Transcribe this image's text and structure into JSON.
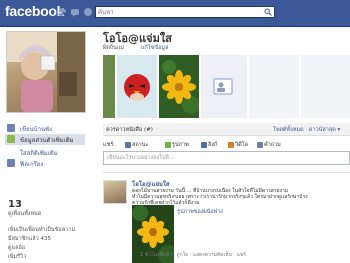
{
  "topbar": {
    "logo": "facebook",
    "search_placeholder": "ค้นหา"
  },
  "sidebar": {
    "links": [
      {
        "label": "เขียนบ้านพัง",
        "icon": "wall-icon",
        "color": "#6d84b4"
      },
      {
        "label": "ข้อมูลส่วนตัวเพิ่มเติม",
        "icon": "info-icon",
        "color": "#8cba4f"
      },
      {
        "label": "ใส่สถิติเพิ่มเติม",
        "icon": "",
        "color": ""
      },
      {
        "label": "ฟิลเกรียง",
        "icon": "photo-icon",
        "color": "#6d84b4"
      }
    ],
    "friends_count": "13",
    "friends_label": "ดูเพื่อนทั้งหมด",
    "info_lines": [
      "เพิ่มเป็นเพื่อนทำเป็นข้อความ",
      "มีสมาชิกแล้ว 435",
      "ดูแลอ้อ",
      "เพิ่มรีวิว"
    ]
  },
  "profile": {
    "name": "โอโอ@แจ่มใส",
    "subline_left": "ผิดถิ่นแม่",
    "subline_right": "แก้ไขข้อมูล"
  },
  "feed": {
    "left_label": "ควรดาวหนังสือ (#)",
    "right_label": "โพสต์ทั้งหมด · ดาวน์ล่าสุด ▾",
    "share_label": "แชร์:",
    "share_items": [
      {
        "label": "สถานะ",
        "color": "#5972a7"
      },
      {
        "label": "รูปภาพ",
        "color": "#6bb344"
      },
      {
        "label": "ลิงก์",
        "color": "#4a6ea9"
      },
      {
        "label": "วิดีโอ",
        "color": "#d67c2b"
      },
      {
        "label": "คำถาม",
        "color": "#6e7fa8"
      }
    ],
    "status_placeholder": "เขียนอะไรบางอย่างลงไปสิ..."
  },
  "post": {
    "author": "โอโอ@แจ่มใส",
    "lines": [
      "ดอกไม้บานสวยงาม วันนี้ ... ที่บ้านบางรบเนื่อง ในหัวใจที่ไม่มีดาวสวยงาม",
      "ทำไมมีความสุขจริงๆเลย เพราะว่าเราน่ารักมากจริงๆแล้ว ใครมาฝากดูแลรักษาบ้าง",
      "ความรักที่เคยฝากไว้แล้วก็ดีงาม"
    ],
    "link_text": "รูปภาพของผนังฟาง",
    "meta": "2 ชั่วโมงที่แล้ว · ถูกใจ · แสดงความคิดเห็น · แชร์"
  }
}
